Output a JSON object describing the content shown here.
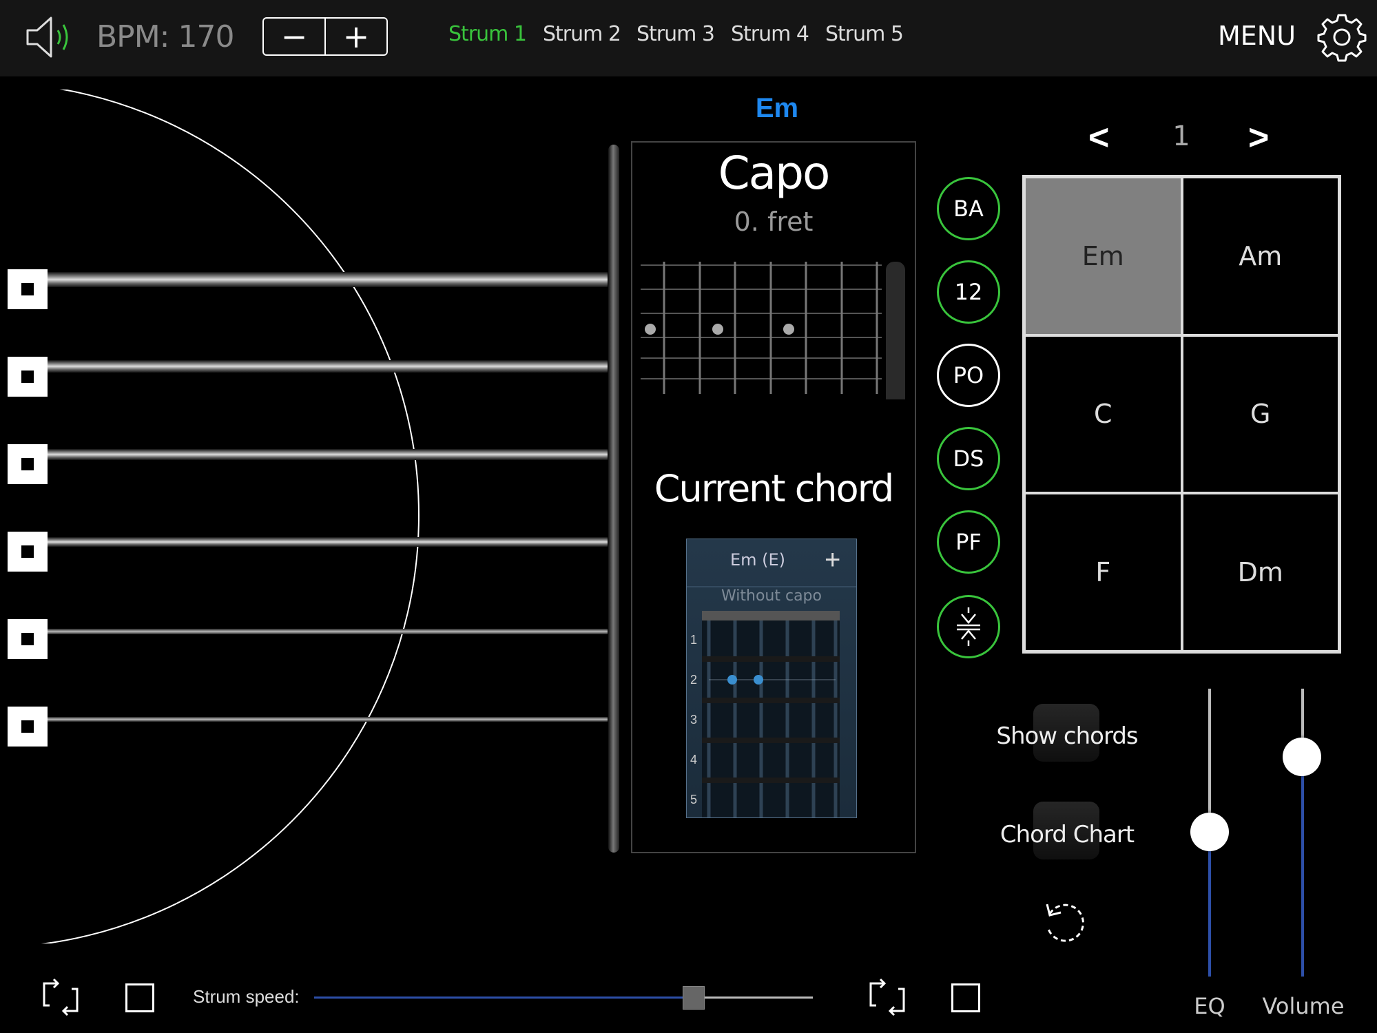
{
  "header": {
    "bpm_label": "BPM: 170",
    "minus_label": "−",
    "plus_label": "+",
    "tabs": [
      {
        "label": "Strum 1",
        "active": true
      },
      {
        "label": "Strum 2",
        "active": false
      },
      {
        "label": "Strum 3",
        "active": false
      },
      {
        "label": "Strum 4",
        "active": false
      },
      {
        "label": "Strum 5",
        "active": false
      }
    ],
    "menu_label": "MENU"
  },
  "current_chord_name": "Em",
  "capo": {
    "title": "Capo",
    "fret_label": "0. fret"
  },
  "current_chord_title": "Current chord",
  "chord_diagram": {
    "header": "Em (E)",
    "subheader": "Without capo",
    "fret_numbers": [
      "1",
      "2",
      "3",
      "4",
      "5"
    ]
  },
  "mode_buttons": [
    {
      "label": "BA",
      "active": true
    },
    {
      "label": "12",
      "active": true
    },
    {
      "label": "PO",
      "active": false
    },
    {
      "label": "DS",
      "active": true
    },
    {
      "label": "PF",
      "active": true
    }
  ],
  "chord_pages": {
    "prev_label": "<",
    "page": "1",
    "next_label": ">"
  },
  "chord_grid": [
    {
      "label": "Em",
      "selected": true
    },
    {
      "label": "Am",
      "selected": false
    },
    {
      "label": "C",
      "selected": false
    },
    {
      "label": "G",
      "selected": false
    },
    {
      "label": "F",
      "selected": false
    },
    {
      "label": "Dm",
      "selected": false
    }
  ],
  "toggles": {
    "show_chords": "Show chords",
    "chord_chart": "Chord Chart"
  },
  "sliders": {
    "eq_label": "EQ",
    "eq_level": 0.5,
    "volume_label": "Volume",
    "volume_level": 0.8
  },
  "strum_speed": {
    "label": "Strum speed:",
    "value": 0.76
  },
  "colors": {
    "accent_green": "#39c43c",
    "chord_blue": "#1e88f0",
    "track_blue": "#2d4fa8"
  },
  "icons": [
    "speaker-icon",
    "gear-icon",
    "loop-icon",
    "stop-icon",
    "reset-icon",
    "swap-icon"
  ]
}
